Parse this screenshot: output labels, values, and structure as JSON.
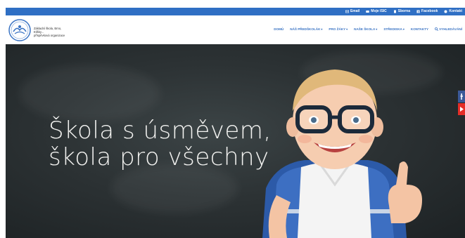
{
  "topbar": {
    "links": [
      {
        "label": "Email",
        "icon": "envelope-icon"
      },
      {
        "label": "Moje ISIC",
        "icon": "card-icon"
      },
      {
        "label": "Sborna",
        "icon": "document-icon"
      },
      {
        "label": "Facebook",
        "icon": "facebook-icon"
      },
      {
        "label": "Kontakt",
        "icon": "phone-icon"
      }
    ]
  },
  "school": {
    "name_line1": "Základní škola, Brno,",
    "name_line2": "Elišky...",
    "name_line3": "příspěvková organizace"
  },
  "nav": {
    "items": [
      {
        "label": "DOMŮ",
        "caret": false
      },
      {
        "label": "NÁŠ PŘEDŠKOLÁK",
        "caret": true
      },
      {
        "label": "PRO ŽÁKY",
        "caret": true
      },
      {
        "label": "NAŠE ŠKOLA",
        "caret": true
      },
      {
        "label": "STŘEDISKA",
        "caret": true
      },
      {
        "label": "KONTAKTY",
        "caret": false
      },
      {
        "label": "VYHLEDÁVÁNÍ",
        "caret": false,
        "icon": "search-icon"
      }
    ]
  },
  "hero": {
    "line1": "Škola s úsměvem,",
    "line2": "škola pro všechny"
  },
  "colors": {
    "topbar": "#2f6fc4",
    "nav_text": "#3b74c4",
    "chalkboard": "#2c3234",
    "facebook": "#3b5998",
    "youtube": "#e52d27"
  }
}
